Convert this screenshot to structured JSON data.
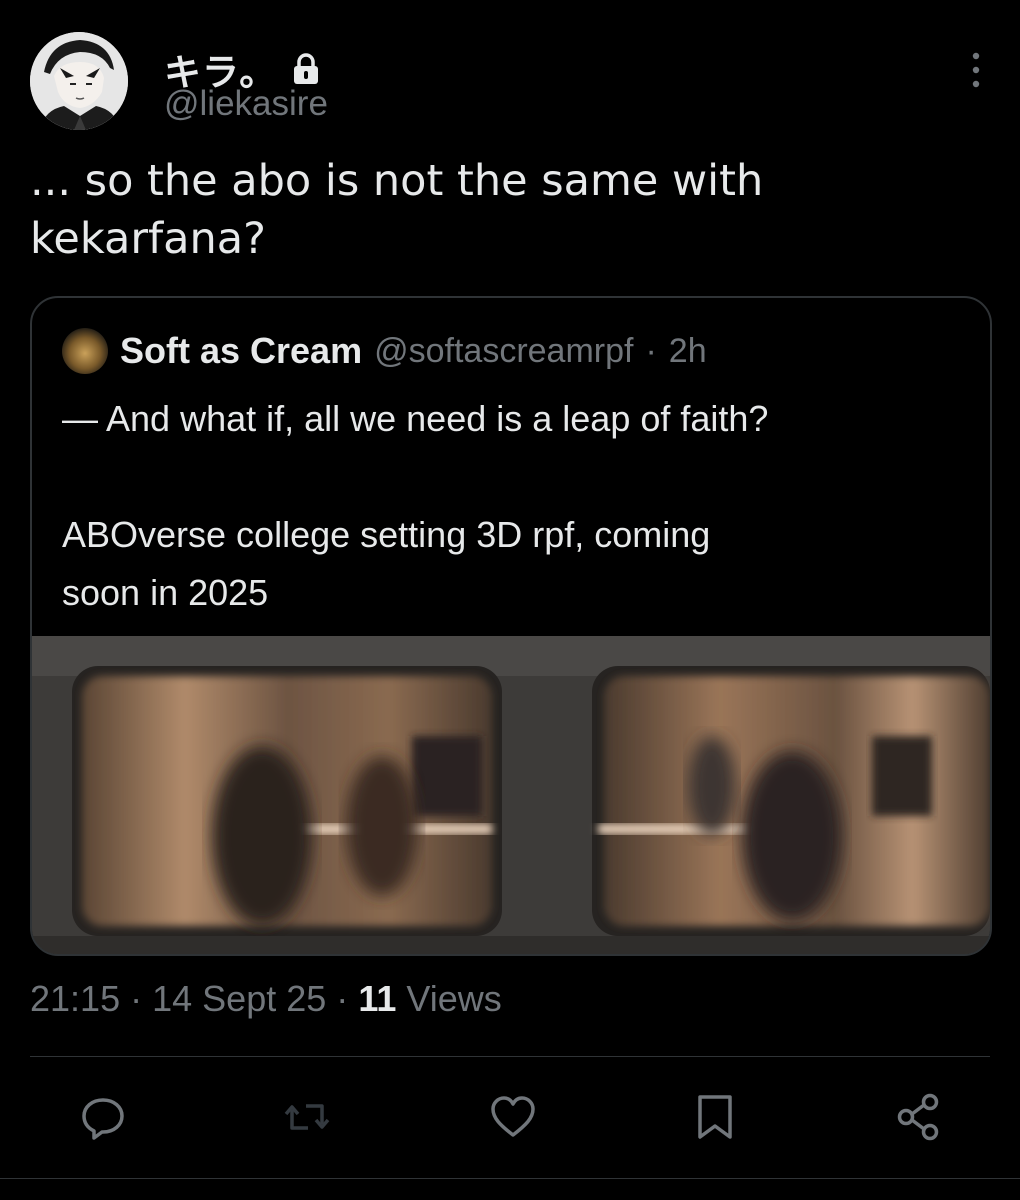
{
  "post": {
    "display_name": "キラ。",
    "handle": "@liekasire",
    "text": "... so the abo is not the same with\nkekarfana?",
    "icons": {
      "avatar": "anime-boy-avatar",
      "lock": "lock-icon",
      "more": "more-vertical-icon"
    }
  },
  "quote": {
    "display_name": "Soft as Cream",
    "handle": "@softascreamrpf",
    "separator": "·",
    "time": "2h",
    "text": "— And what if, all we need is a leap of faith?\n\nABOverse college setting 3D rpf, coming\nsoon in 2025",
    "media": "blurred-subway-train-windows-photo"
  },
  "meta": {
    "time": "21:15",
    "sep1": "·",
    "date": "14 Sept 25",
    "sep2": "·",
    "views_count": "11",
    "views_label": "Views"
  },
  "actions": [
    "reply-icon",
    "repost-icon",
    "like-icon",
    "bookmark-icon",
    "share-icon"
  ],
  "colors": {
    "background": "#000000",
    "text": "#e7e9ea",
    "secondary_text": "#71767b",
    "border": "#2f3336"
  }
}
